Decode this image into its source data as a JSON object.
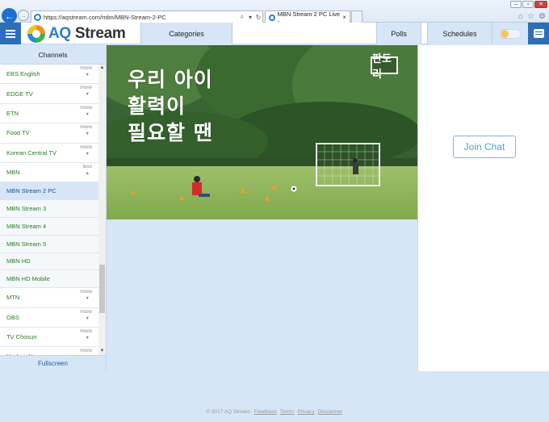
{
  "browser": {
    "url": "https://aqstream.com/mbn/MBN-Stream-2-PC",
    "active_tab_title": "MBN Stream 2 PC Live - ...",
    "tab_close": "×",
    "new_tab": ""
  },
  "header": {
    "logo_aq": "AQ",
    "logo_stream": " Stream",
    "categories": "Categories",
    "polls": "Polls",
    "schedules": "Schedules",
    "theme_toggle_on": false
  },
  "sidebar": {
    "title": "Channels",
    "channels": [
      {
        "label": "EBS English",
        "action": "more"
      },
      {
        "label": "EDGE TV",
        "action": "more"
      },
      {
        "label": "ETN",
        "action": "more"
      },
      {
        "label": "Food TV",
        "action": "more"
      },
      {
        "label": "Korean Central TV",
        "action": "more"
      },
      {
        "label": "MBN",
        "action": "less"
      },
      {
        "label": "MBN Stream 2 PC",
        "sub": true,
        "active": true
      },
      {
        "label": "MBN Stream 3",
        "sub": true
      },
      {
        "label": "MBN Stream 4",
        "sub": true
      },
      {
        "label": "MBN Stream 5",
        "sub": true
      },
      {
        "label": "MBN HD",
        "sub": true
      },
      {
        "label": "MBN HD Mobile",
        "sub": true
      },
      {
        "label": "MTN",
        "action": "more"
      },
      {
        "label": "OBS",
        "action": "more"
      },
      {
        "label": "TV Chosun",
        "action": "more"
      },
      {
        "label": "Yonhap News",
        "action": "more"
      }
    ],
    "fullscreen": "Fullscreen"
  },
  "video": {
    "overlay_lines": [
      "우리 아이",
      "활력이",
      "필요할 땐"
    ],
    "channel_logo": "판도리"
  },
  "chat": {
    "join_label": "Join Chat"
  },
  "footer": {
    "copyright": "© 2017 AQ Stream.",
    "links": [
      "Feedback",
      "Terms",
      "Privacy",
      "Disclaimer"
    ]
  },
  "colors": {
    "accent_blue": "#2d6fb6",
    "panel_bg": "#d6e6f7",
    "channel_text": "#2a7a22",
    "join_chat": "#4ea1dc"
  }
}
